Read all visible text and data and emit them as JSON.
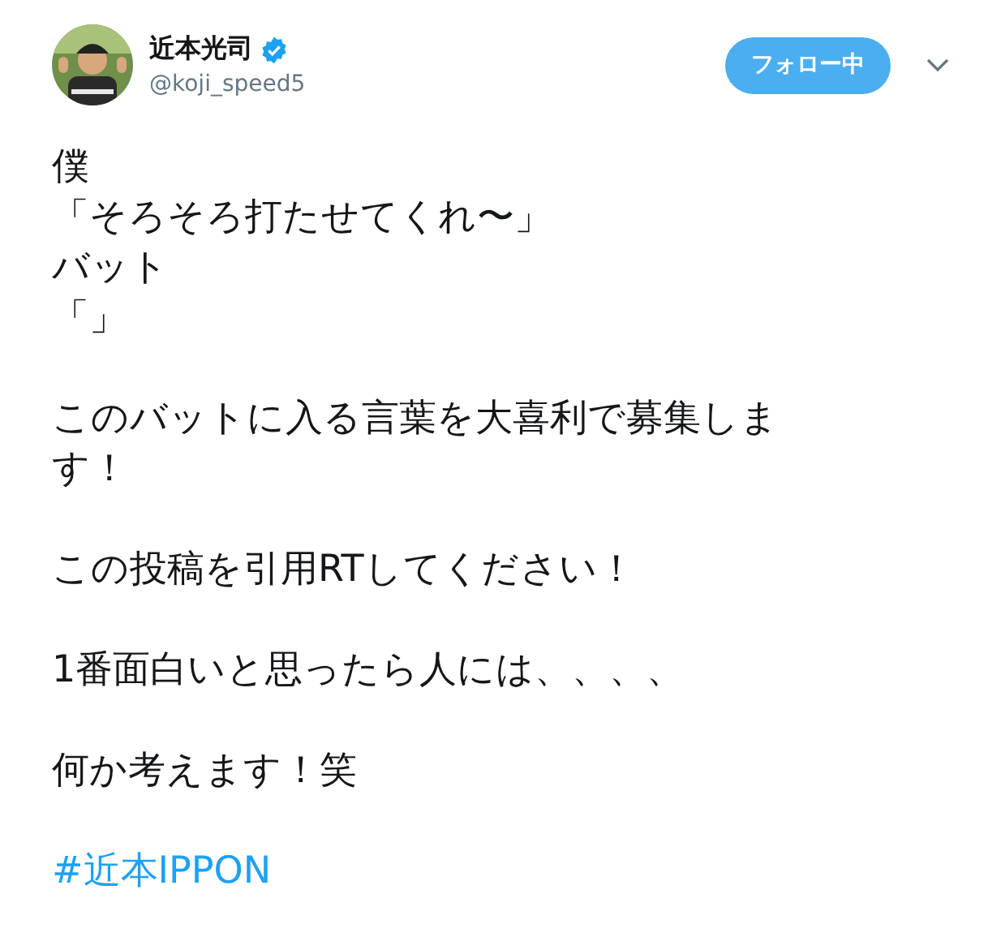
{
  "author": {
    "name": "近本光司",
    "verified": true,
    "handle": "@koji_speed5"
  },
  "follow_button": {
    "label": "フォロー中",
    "selected": true
  },
  "body": [
    {
      "kind": "text",
      "lines": [
        "僕",
        "「そろそろ打たせてくれ〜」",
        "バット",
        "「」"
      ]
    },
    {
      "kind": "text",
      "lines": [
        "このバットに入る言葉を大喜利で募集します！"
      ]
    },
    {
      "kind": "text",
      "lines": [
        "この投稿を引用RTしてください！"
      ]
    },
    {
      "kind": "text",
      "lines": [
        "1番面白いと思ったら人には、、、、"
      ]
    },
    {
      "kind": "text",
      "lines": [
        "何か考えます！笑"
      ]
    },
    {
      "kind": "hashtag",
      "lines": [
        "#近本IPPON"
      ]
    }
  ]
}
